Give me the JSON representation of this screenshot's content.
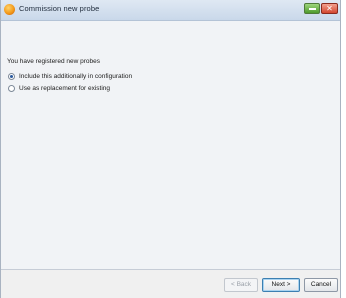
{
  "window": {
    "title": "Commission new probe",
    "close_glyph": "✕"
  },
  "wizard": {
    "intro_text": "You have registered new probes",
    "options": [
      {
        "label": "Include this additionally in configuration",
        "selected": true
      },
      {
        "label": "Use as replacement for existing",
        "selected": false
      }
    ]
  },
  "footer": {
    "back_label": "< Back",
    "next_label": "Next >",
    "cancel_label": "Cancel"
  },
  "icons": {
    "app": "probe-app-icon",
    "minimize": "minimize-icon",
    "close": "close-icon"
  },
  "colors": {
    "titlebar": "#c9d8ea",
    "close_button": "#d2462f",
    "minimize_button": "#4e9a2c",
    "content_background": "#f1f3f6"
  }
}
